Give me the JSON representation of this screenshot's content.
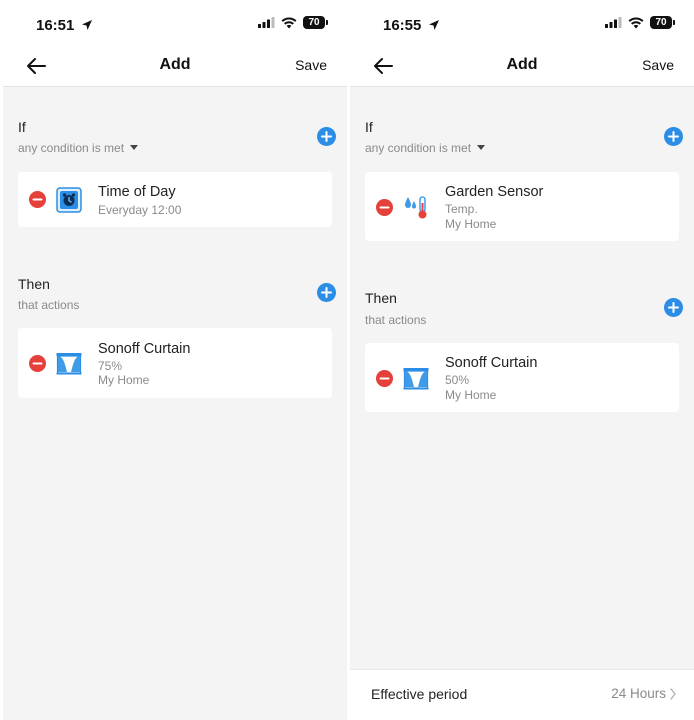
{
  "screens": [
    {
      "status": {
        "time": "16:51",
        "battery": "70"
      },
      "nav": {
        "title": "Add",
        "save_label": "Save"
      },
      "if_section": {
        "title": "If",
        "subtitle": "any condition is met",
        "conditions": [
          {
            "title": "Time of Day",
            "subtitle": "Everyday 12:00",
            "icon": "alarm-clock-icon"
          }
        ]
      },
      "then_section": {
        "title": "Then",
        "subtitle": "that actions",
        "actions": [
          {
            "title": "Sonoff Curtain",
            "value": "75%",
            "location": "My Home",
            "icon": "curtain-icon"
          }
        ]
      }
    },
    {
      "status": {
        "time": "16:55",
        "battery": "70"
      },
      "nav": {
        "title": "Add",
        "save_label": "Save"
      },
      "if_section": {
        "title": "If",
        "subtitle": "any condition is met",
        "conditions": [
          {
            "title": "Garden Sensor",
            "subtitle": "Temp.",
            "location": "My Home",
            "icon": "temperature-humidity-icon"
          }
        ]
      },
      "then_section": {
        "title": "Then",
        "subtitle": "that actions",
        "actions": [
          {
            "title": "Sonoff Curtain",
            "value": "50%",
            "location": "My Home",
            "icon": "curtain-icon"
          }
        ]
      },
      "footer": {
        "label": "Effective period",
        "value": "24 Hours"
      }
    }
  ],
  "colors": {
    "accent_blue": "#2b8de6",
    "remove_red": "#e5403a",
    "background": "#f4f4f4",
    "secondary_text": "#8a8a8a"
  }
}
